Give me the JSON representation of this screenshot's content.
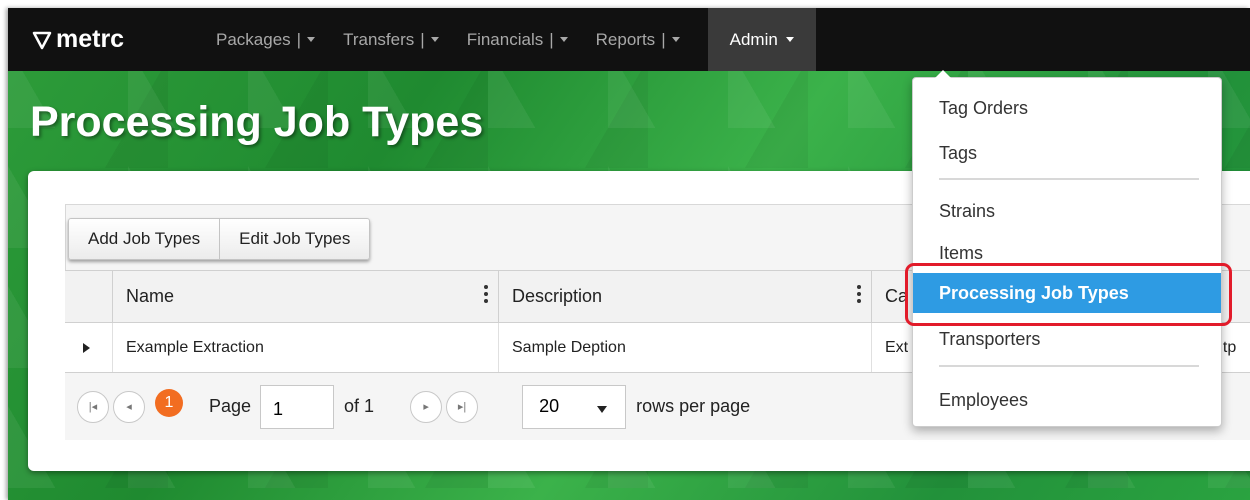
{
  "brand": {
    "name": "metrc"
  },
  "nav": {
    "items": [
      {
        "label": "Packages",
        "sep": "|"
      },
      {
        "label": "Transfers",
        "sep": "|"
      },
      {
        "label": "Financials",
        "sep": "|"
      },
      {
        "label": "Reports",
        "sep": "|"
      }
    ],
    "active": {
      "label": "Admin"
    }
  },
  "page": {
    "title": "Processing Job Types"
  },
  "toolbar": {
    "add_label": "Add Job Types",
    "edit_label": "Edit Job Types"
  },
  "table": {
    "columns": [
      "Name",
      "Description",
      "Ca"
    ],
    "rows": [
      {
        "name": "Example Extraction",
        "description": "Sample Deption",
        "category": "Ext",
        "tail": "utp"
      }
    ]
  },
  "pager": {
    "current": "1",
    "page_label": "Page",
    "page_value": "1",
    "of_label": "of 1",
    "size_value": "20",
    "rows_label": "rows per page"
  },
  "dropdown": {
    "items": [
      "Tag Orders",
      "Tags",
      "Strains",
      "Items",
      "Processing Job Types",
      "Transporters",
      "Employees"
    ],
    "selected": "Processing Job Types"
  },
  "colors": {
    "accent": "#2e9be3",
    "highlight": "#e21b2a",
    "current_page": "#f26d21",
    "navbar": "#111111"
  }
}
